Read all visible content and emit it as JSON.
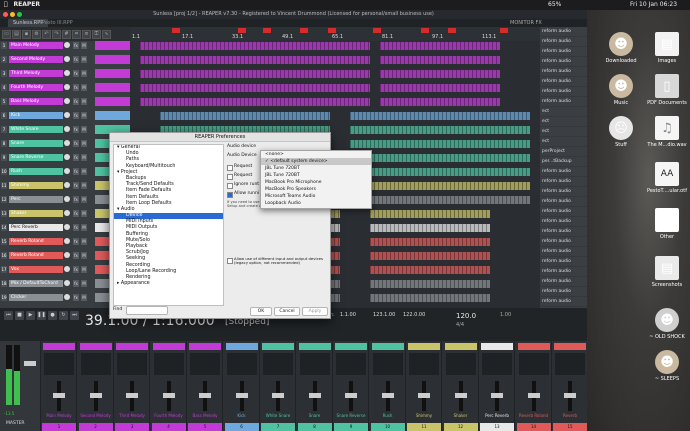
{
  "menubar": {
    "app": "REAPER",
    "items": [
      "File",
      "Edit",
      "View",
      "Insert",
      "Item",
      "Track",
      "Options",
      "Actions",
      "Extensions",
      "Help"
    ],
    "battery": "65%",
    "clock": "Fri 10 Jan 06:23"
  },
  "window": {
    "title": "Sunless [proj 1/2] - REAPER v7.30 - Registered to Vincent Drummond (Licensed for personal/small business use)",
    "tabs": [
      "Sunless.RPP",
      "Pesto III.RPP"
    ],
    "monitor_label": "MONITOR FX"
  },
  "ruler": {
    "marks": [
      "1.1",
      "17.1",
      "33.1",
      "49.1",
      "65.1",
      "81.1",
      "97.1",
      "113.1"
    ],
    "times": [
      "0:00.000",
      "0:30.000",
      "1:00.000",
      "1:30.000",
      "2:00.000",
      "2:30.000",
      "3:00.000",
      "3:30.000"
    ]
  },
  "tracks": [
    {
      "n": "1",
      "name": "Main Melody",
      "color": "#c23bd6"
    },
    {
      "n": "2",
      "name": "Second Melody",
      "color": "#c23bd6"
    },
    {
      "n": "3",
      "name": "Third Melody",
      "color": "#c23bd6"
    },
    {
      "n": "4",
      "name": "Fourth Melody",
      "color": "#c23bd6"
    },
    {
      "n": "5",
      "name": "Bass Melody",
      "color": "#c23bd6"
    },
    {
      "n": "6",
      "name": "Kick",
      "color": "#6fa8dc"
    },
    {
      "n": "7",
      "name": "White Snare",
      "color": "#4fc3a1"
    },
    {
      "n": "8",
      "name": "Snare",
      "color": "#4fc3a1"
    },
    {
      "n": "9",
      "name": "Snare Reverse",
      "color": "#4fc3a1"
    },
    {
      "n": "10",
      "name": "Rush",
      "color": "#4fc3a1"
    },
    {
      "n": "11",
      "name": "Shimmy",
      "color": "#c9c46a"
    },
    {
      "n": "12",
      "name": "Perc",
      "color": "#8a8f94"
    },
    {
      "n": "13",
      "name": "Shaker",
      "color": "#c9c46a"
    },
    {
      "n": "14",
      "name": "Perc Reverb",
      "color": "#e8e8e8"
    },
    {
      "n": "15",
      "name": "Reverb Roland",
      "color": "#e05a5a"
    },
    {
      "n": "16",
      "name": "Reverb Roland",
      "color": "#e05a5a"
    },
    {
      "n": "17",
      "name": "Vox",
      "color": "#e05a5a"
    },
    {
      "n": "18",
      "name": "Mix / DefaultToChord",
      "color": "#8a8f94"
    },
    {
      "n": "19",
      "name": "Clicker",
      "color": "#8a8f94"
    }
  ],
  "right_list": {
    "items": [
      "reform audio",
      "reform audio",
      "reform audio",
      "reform audio",
      "reform audio",
      "reform audio",
      "reform audio",
      "reform audio",
      "ect",
      "ect",
      "ect",
      "ect",
      "perProject",
      "per...tBackup",
      "reform audio",
      "reform audio",
      "reform audio",
      "reform audio",
      "reform audio",
      "reform audio",
      "reform audio",
      "reform audio",
      "reform audio",
      "reform audio",
      "reform audio",
      "reform audio",
      "reform audio",
      "reform audio",
      "reform audio",
      "reform audio"
    ]
  },
  "transport": {
    "clock": "39.1.00 / 1:16.000",
    "state": "[Stopped]",
    "selection_label": "Selection:",
    "sel_start": "1.1.00",
    "sel_end": "123.1.00",
    "sel_len": "122.0.00",
    "bpm": "120.0",
    "sig": "4/4",
    "rate": "1.00"
  },
  "mixer": {
    "master_label": "MASTER",
    "master_value": "-13.5",
    "strips": [
      {
        "name": "Main Melody",
        "color": "#c23bd6",
        "bot": "1"
      },
      {
        "name": "Second Melody",
        "color": "#c23bd6",
        "bot": "2"
      },
      {
        "name": "Third Melody",
        "color": "#c23bd6",
        "bot": "3"
      },
      {
        "name": "Fourth Melody",
        "color": "#c23bd6",
        "bot": "4"
      },
      {
        "name": "Bass Melody",
        "color": "#c23bd6",
        "bot": "5"
      },
      {
        "name": "Kick",
        "color": "#6fa8dc",
        "bot": "6"
      },
      {
        "name": "White Snare",
        "color": "#4fc3a1",
        "bot": "7"
      },
      {
        "name": "Snare",
        "color": "#4fc3a1",
        "bot": "8"
      },
      {
        "name": "Snare Reverse",
        "color": "#4fc3a1",
        "bot": "9"
      },
      {
        "name": "Rush",
        "color": "#4fc3a1",
        "bot": "10"
      },
      {
        "name": "Shimmy",
        "color": "#c9c46a",
        "bot": "11"
      },
      {
        "name": "Shaker",
        "color": "#c9c46a",
        "bot": "12"
      },
      {
        "name": "Perc Reverb",
        "color": "#e8e8e8",
        "bot": "13"
      },
      {
        "name": "Reverb Roland",
        "color": "#e05a5a",
        "bot": "14"
      },
      {
        "name": "Reverb",
        "color": "#e05a5a",
        "bot": "15"
      }
    ]
  },
  "dialog": {
    "title": "REAPER Preferences",
    "tree": [
      {
        "label": "▾ General",
        "indent": 0
      },
      {
        "label": "Undo",
        "indent": 1
      },
      {
        "label": "Paths",
        "indent": 1
      },
      {
        "label": "Keyboard/Multitouch",
        "indent": 1
      },
      {
        "label": "▾ Project",
        "indent": 0
      },
      {
        "label": "Backups",
        "indent": 1
      },
      {
        "label": "Track/Send Defaults",
        "indent": 1
      },
      {
        "label": "Item Fade Defaults",
        "indent": 1
      },
      {
        "label": "Item Defaults",
        "indent": 1
      },
      {
        "label": "Item Loop Defaults",
        "indent": 1
      },
      {
        "label": "▾ Audio",
        "indent": 0
      },
      {
        "label": "Device",
        "indent": 1,
        "sel": true
      },
      {
        "label": "MIDI Inputs",
        "indent": 1
      },
      {
        "label": "MIDI Outputs",
        "indent": 1
      },
      {
        "label": "Buffering",
        "indent": 1
      },
      {
        "label": "Mute/Solo",
        "indent": 1
      },
      {
        "label": "Playback",
        "indent": 1
      },
      {
        "label": "Scrub/Jog",
        "indent": 1
      },
      {
        "label": "Seeking",
        "indent": 1
      },
      {
        "label": "Recording",
        "indent": 1
      },
      {
        "label": "Loop/Lane Recording",
        "indent": 1
      },
      {
        "label": "Rendering",
        "indent": 1
      },
      {
        "label": "▸ Appearance",
        "indent": 0
      }
    ],
    "find_label": "Find",
    "section_label": "Audio device",
    "device_label": "Audio Device",
    "opt_request1": "Request",
    "opt_request2": "Request",
    "opt_ignore": "Ignore runt",
    "opt_allow": "Allow runni",
    "note": "If you need to use multiple devices, open Audio MIDI Setup and create an aggregate device.",
    "legacy_label": "Allow use of different input and output devices (legacy option, not recommended)",
    "ok": "OK",
    "cancel": "Cancel",
    "apply": "Apply"
  },
  "dropdown": {
    "items": [
      "<none>",
      "✓ <default system device>",
      "JBL Tune 720BT",
      "JBL Tune 720BT",
      "MacBook Pro Microphone",
      "MacBook Pro Speakers",
      "Microsoft Teams Audio",
      "Loopback Audio"
    ]
  },
  "desktop": {
    "icons": [
      "Downloaded",
      "Images",
      "Music",
      "PDF Documents",
      "Stuff",
      "The M...dio.wav",
      "PestoT....ular.otf",
      "Other",
      "Screenshots",
      "~ OLD SHOCK",
      "~ SLEEPS"
    ]
  }
}
